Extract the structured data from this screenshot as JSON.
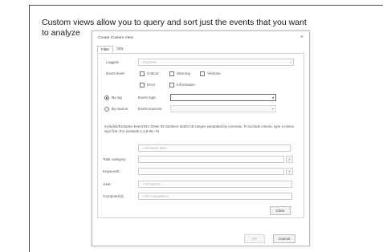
{
  "caption": {
    "line1": "Custom views allow you to query and sort just the events that you want",
    "line2": "to analyze"
  },
  "dialog": {
    "title": "Create Custom View",
    "tabs": [
      {
        "label": "Filter",
        "active": true
      },
      {
        "label": "XML",
        "active": false
      }
    ],
    "logged": {
      "label": "Logged:",
      "value": "Any time"
    },
    "event_level": {
      "label": "Event level:",
      "options": [
        "Critical",
        "Warning",
        "Verbose",
        "Error",
        "Information"
      ]
    },
    "by_log": {
      "label": "By log",
      "selected": true
    },
    "by_source": {
      "label": "By source",
      "selected": false
    },
    "event_logs": {
      "label": "Event logs:",
      "value": ""
    },
    "event_sources": {
      "label": "Event sources:",
      "value": ""
    },
    "note": "Includes/Excludes Event IDs: Enter ID numbers and/or ID ranges separated by commas. To exclude criteria, type a minus sign first. For example 1,3,5-99,-76",
    "event_ids": {
      "placeholder": "<All Event IDs>"
    },
    "task_category": {
      "label": "Task category:",
      "value": ""
    },
    "keywords": {
      "label": "Keywords:",
      "value": ""
    },
    "user": {
      "label": "User:",
      "placeholder": "<All Users>"
    },
    "computers": {
      "label": "Computer(s):",
      "placeholder": "<All Computers>"
    },
    "clear_label": "Clear",
    "ok_label": "OK",
    "cancel_label": "Cancel"
  }
}
